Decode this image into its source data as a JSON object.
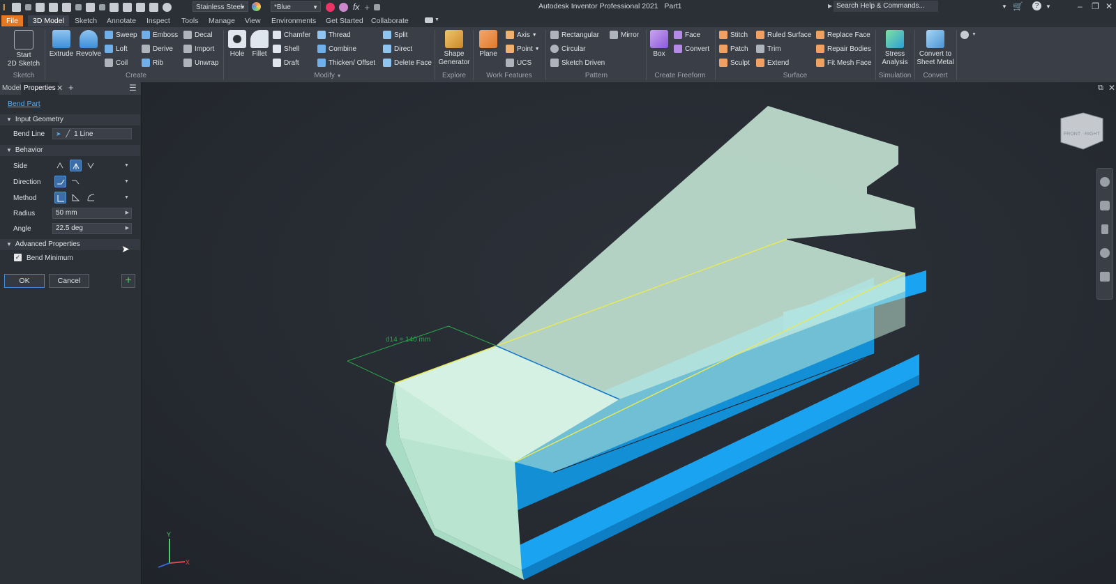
{
  "window": {
    "title": "Autodesk Inventor Professional 2021",
    "document": "Part1",
    "search_placeholder": "Search Help & Commands...",
    "material": "Stainless Steel",
    "appearance": "*Blue"
  },
  "tabs": [
    "File",
    "3D Model",
    "Sketch",
    "Annotate",
    "Inspect",
    "Tools",
    "Manage",
    "View",
    "Environments",
    "Get Started",
    "Collaborate"
  ],
  "ribbon": {
    "sketch": {
      "start_line1": "Start",
      "start_line2": "2D Sketch",
      "group": "Sketch"
    },
    "create": {
      "extrude": "Extrude",
      "revolve": "Revolve",
      "sweep": "Sweep",
      "loft": "Loft",
      "coil": "Coil",
      "emboss": "Emboss",
      "derive": "Derive",
      "rib": "Rib",
      "decal": "Decal",
      "import": "Import",
      "unwrap": "Unwrap",
      "group": "Create"
    },
    "modify": {
      "hole": "Hole",
      "fillet": "Fillet",
      "chamfer": "Chamfer",
      "shell": "Shell",
      "draft": "Draft",
      "thread": "Thread",
      "combine": "Combine",
      "thicken": "Thicken/ Offset",
      "split": "Split",
      "direct": "Direct",
      "delete_face": "Delete Face",
      "group": "Modify"
    },
    "explore": {
      "line1": "Shape",
      "line2": "Generator",
      "group": "Explore"
    },
    "work": {
      "plane": "Plane",
      "axis": "Axis",
      "point": "Point",
      "ucs": "UCS",
      "group": "Work Features"
    },
    "pattern": {
      "rectangular": "Rectangular",
      "circular": "Circular",
      "sketch_driven": "Sketch Driven",
      "mirror": "Mirror",
      "group": "Pattern"
    },
    "freeform": {
      "box": "Box",
      "face": "Face",
      "convert": "Convert",
      "group": "Create Freeform"
    },
    "surface": {
      "stitch": "Stitch",
      "patch": "Patch",
      "sculpt": "Sculpt",
      "ruled": "Ruled Surface",
      "trim": "Trim",
      "extend": "Extend",
      "replace": "Replace Face",
      "repair": "Repair Bodies",
      "fitmesh": "Fit Mesh Face",
      "group": "Surface"
    },
    "simulation": {
      "line1": "Stress",
      "line2": "Analysis",
      "group": "Simulation"
    },
    "convert": {
      "line1": "Convert to",
      "line2": "Sheet Metal",
      "group": "Convert"
    }
  },
  "panel": {
    "tab_model": "Model",
    "tab_properties": "Properties",
    "feature": "Bend Part",
    "input_geometry": "Input Geometry",
    "bend_line_label": "Bend Line",
    "bend_line_value": "1 Line",
    "behavior": "Behavior",
    "side": "Side",
    "direction": "Direction",
    "method": "Method",
    "radius_label": "Radius",
    "radius_value": "50 mm",
    "angle_label": "Angle",
    "angle_value": "22.5 deg",
    "advanced": "Advanced Properties",
    "bend_minimum": "Bend Minimum",
    "ok": "OK",
    "cancel": "Cancel"
  },
  "viewport": {
    "dimension": "d14 = 140 mm",
    "viewcube_front": "FRONT",
    "viewcube_right": "RIGHT",
    "axis_x": "X",
    "axis_y": "Y"
  }
}
